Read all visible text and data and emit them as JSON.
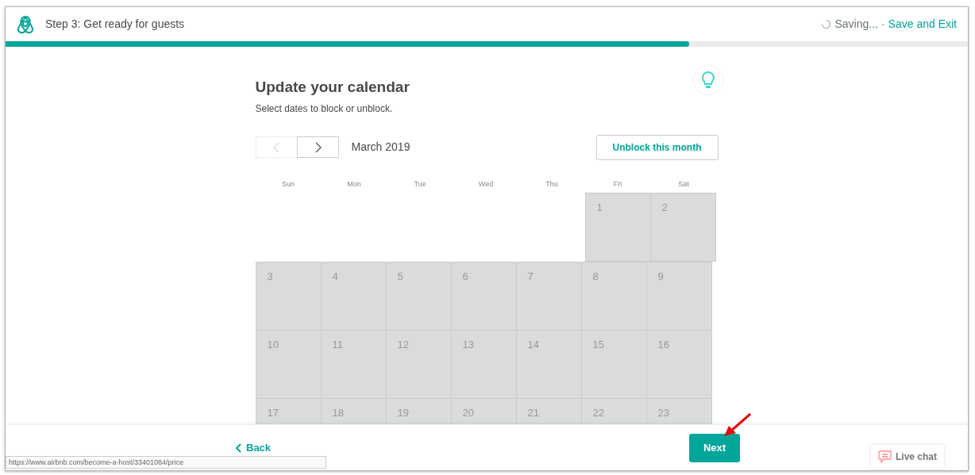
{
  "header": {
    "step_title": "Step 3: Get ready for guests",
    "saving_status": "Saving...",
    "separator": "·",
    "save_exit_link": "Save and Exit"
  },
  "progress": {
    "level": 0.71
  },
  "main": {
    "title": "Update your calendar",
    "subtitle": "Select dates to block or unblock.",
    "month": "March 2019",
    "prev_disabled": true,
    "unblock_button": "Unblock this month"
  },
  "calendar": {
    "weekdays": [
      "Sun",
      "Mon",
      "Tue",
      "Wed",
      "Thu",
      "Fri",
      "Sat"
    ],
    "weeks": [
      [
        {
          "kind": "empty"
        },
        {
          "kind": "empty"
        },
        {
          "kind": "empty"
        },
        {
          "kind": "empty"
        },
        {
          "kind": "empty"
        },
        {
          "kind": "day",
          "day": "1",
          "blocked": true
        },
        {
          "kind": "day",
          "day": "2",
          "blocked": true
        }
      ],
      [
        {
          "day": "3",
          "blocked": true
        },
        {
          "day": "4",
          "blocked": true
        },
        {
          "day": "5",
          "blocked": true
        },
        {
          "day": "6",
          "blocked": true
        },
        {
          "day": "7",
          "blocked": true
        },
        {
          "day": "8",
          "blocked": true
        },
        {
          "day": "9",
          "blocked": true
        }
      ],
      [
        {
          "day": "10",
          "blocked": true
        },
        {
          "day": "11",
          "blocked": true
        },
        {
          "day": "12",
          "blocked": true
        },
        {
          "day": "13",
          "blocked": true
        },
        {
          "day": "14",
          "blocked": true
        },
        {
          "day": "15",
          "blocked": true
        },
        {
          "day": "16",
          "blocked": true
        }
      ],
      [
        {
          "day": "17",
          "blocked": true
        },
        {
          "day": "18",
          "blocked": true
        },
        {
          "day": "19",
          "blocked": true
        },
        {
          "day": "20",
          "blocked": true
        },
        {
          "day": "21",
          "blocked": true
        },
        {
          "day": "22",
          "blocked": true
        },
        {
          "day": "23",
          "blocked": true
        }
      ]
    ]
  },
  "footer": {
    "back_link": "Back",
    "next_button": "Next"
  },
  "status_url": "https://www.airbnb.com/become-a-host/33401084/price",
  "live_chat": "Live chat"
}
